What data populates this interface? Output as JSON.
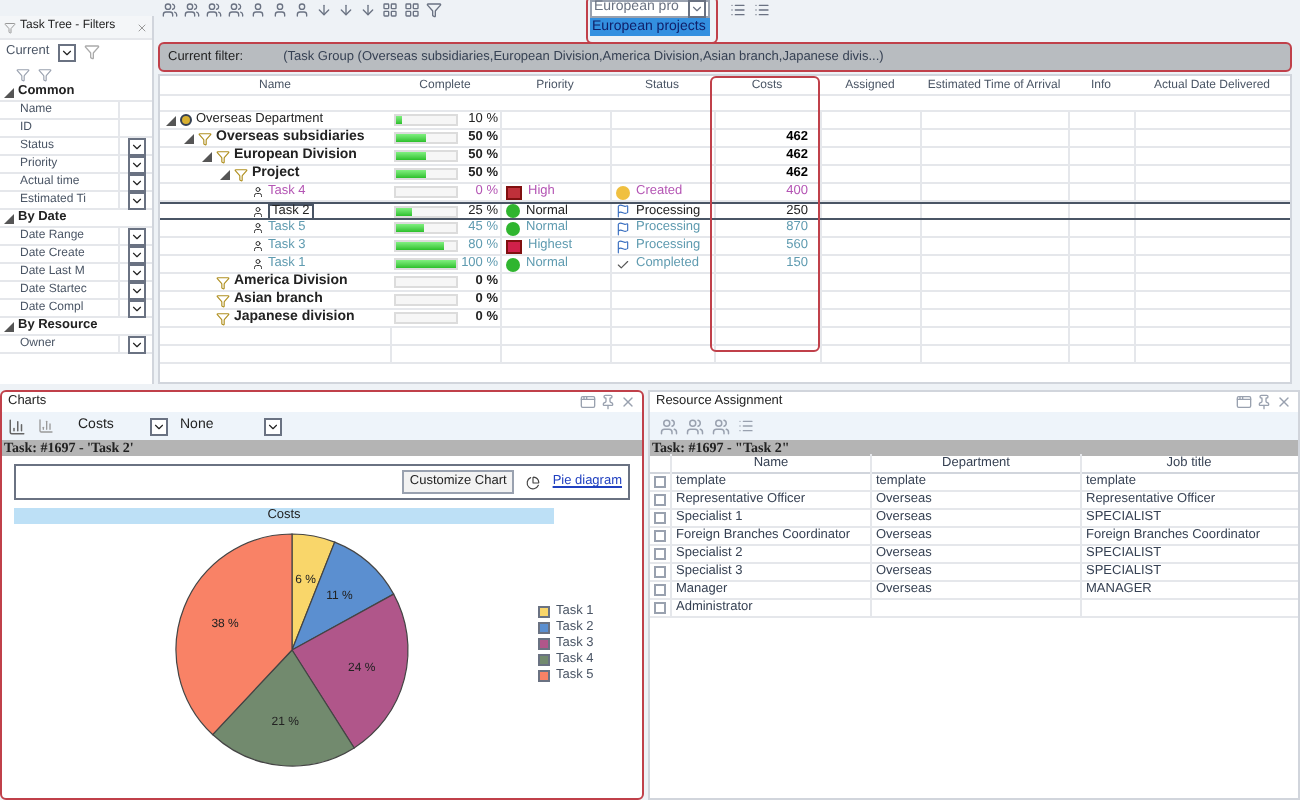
{
  "toolbar": {
    "dropdown": {
      "value": "European pro",
      "options": [
        {
          "label": "European projects",
          "selected": true
        }
      ]
    }
  },
  "filter_panel": {
    "title": "Task Tree - Filters",
    "preset": "Current",
    "sections": [
      {
        "title": "Common",
        "expanded": true,
        "fields": [
          {
            "label": "Name",
            "kind": "text"
          },
          {
            "label": "ID",
            "kind": "text"
          },
          {
            "label": "Status",
            "kind": "select"
          },
          {
            "label": "Priority",
            "kind": "select"
          },
          {
            "label": "Actual time",
            "kind": "select"
          },
          {
            "label": "Estimated Ti",
            "kind": "select"
          }
        ]
      },
      {
        "title": "By Date",
        "expanded": true,
        "fields": [
          {
            "label": "Date Range",
            "kind": "select"
          },
          {
            "label": "Date Create",
            "kind": "select"
          },
          {
            "label": "Date Last M",
            "kind": "select"
          },
          {
            "label": "Date Startec",
            "kind": "select"
          },
          {
            "label": "Date Compl",
            "kind": "select"
          }
        ]
      },
      {
        "title": "By Resource",
        "expanded": true,
        "fields": [
          {
            "label": "Owner",
            "kind": "select"
          }
        ]
      }
    ]
  },
  "filter_bar": {
    "label": "Current filter:",
    "text": "(Task Group  (Overseas subsidiaries,European Division,America Division,Asian branch,Japanese divis...)"
  },
  "task_table": {
    "columns": [
      "Name",
      "Complete",
      "Priority",
      "Status",
      "Costs",
      "Assigned",
      "Estimated Time of Arrival",
      "Info",
      "Actual Date Delivered"
    ],
    "rows": [
      {
        "kind": "department",
        "name": "Overseas Department",
        "complete": "10 %",
        "level": 0.1,
        "expanded": true,
        "selected": false,
        "children": [
          {
            "kind": "group",
            "name": "Overseas subsidiaries",
            "complete": "50 %",
            "level": 0.5,
            "costs": "462",
            "expanded": true,
            "selected": false,
            "children": [
              {
                "kind": "group",
                "name": "European Division",
                "complete": "50 %",
                "level": 0.5,
                "costs": "462",
                "expanded": true,
                "selected": false,
                "children": [
                  {
                    "kind": "group",
                    "name": "Project",
                    "complete": "50 %",
                    "level": 0.5,
                    "costs": "462",
                    "expanded": true,
                    "selected": false,
                    "children": [
                      {
                        "kind": "task",
                        "name": "Task 4",
                        "complete": "0 %",
                        "priority": {
                          "kind": "high",
                          "label": "High"
                        },
                        "status": {
                          "kind": "created",
                          "label": "Created"
                        },
                        "costs": "400",
                        "color": "#b455b4",
                        "selected": false
                      },
                      {
                        "kind": "task",
                        "name": "Task 2",
                        "complete": "25 %",
                        "level": 0.25,
                        "priority": {
                          "kind": "normal",
                          "label": "Normal"
                        },
                        "status": {
                          "kind": "processing",
                          "label": "Processing"
                        },
                        "costs": "250",
                        "color": "#222222",
                        "selected": true
                      },
                      {
                        "kind": "task",
                        "name": "Task 5",
                        "complete": "45 %",
                        "level": 0.45,
                        "priority": {
                          "kind": "normal",
                          "label": "Normal"
                        },
                        "status": {
                          "kind": "processing",
                          "label": "Processing"
                        },
                        "costs": "870",
                        "color": "#5f9bb0",
                        "selected": false
                      },
                      {
                        "kind": "task",
                        "name": "Task 3",
                        "complete": "80 %",
                        "level": 0.8,
                        "priority": {
                          "kind": "highest",
                          "label": "Highest"
                        },
                        "status": {
                          "kind": "processing",
                          "label": "Processing"
                        },
                        "costs": "560",
                        "color": "#5f9bb0",
                        "selected": false
                      },
                      {
                        "kind": "task",
                        "name": "Task 1",
                        "complete": "100 %",
                        "level": 1,
                        "priority": {
                          "kind": "normal",
                          "label": "Normal"
                        },
                        "status": {
                          "kind": "completed",
                          "label": "Completed"
                        },
                        "costs": "150",
                        "color": "#5f9bb0",
                        "selected": false
                      }
                    ]
                  }
                ]
              },
              {
                "kind": "group",
                "name": "America Division",
                "complete": "0 %",
                "selected": false
              },
              {
                "kind": "group",
                "name": "Asian branch",
                "complete": "0 %",
                "selected": false
              },
              {
                "kind": "group",
                "name": "Japanese division",
                "complete": "0 %",
                "selected": false
              }
            ]
          }
        ]
      }
    ]
  },
  "charts_panel": {
    "title": "Charts",
    "metric": "Costs",
    "grouping": "None",
    "task_bar": "Task: #1697 - 'Task 2'",
    "customize_button": "Customize Chart",
    "diagram_link": "Pie diagram",
    "chart_data": {
      "type": "pie",
      "title": "Costs",
      "categories": [
        "Task 1",
        "Task 2",
        "Task 3",
        "Task 4",
        "Task 5"
      ],
      "values": [
        6,
        11,
        24,
        21,
        38
      ],
      "colors": [
        "#f9d66a",
        "#5b8fd0",
        "#b0568a",
        "#728a6e",
        "#f98266"
      ],
      "legend": "right",
      "value_labels": [
        "6 %",
        "11 %",
        "24 %",
        "21 %",
        "38 %"
      ]
    }
  },
  "resource_panel": {
    "title": "Resource Assignment",
    "task_bar": "Task: #1697 - \"Task 2\"",
    "columns": [
      "Name",
      "Department",
      "Job title"
    ],
    "rows": [
      {
        "checked": false,
        "cells": [
          "template",
          "template",
          "template"
        ]
      },
      {
        "checked": false,
        "cells": [
          "Representative Officer",
          "Overseas",
          "Representative Officer"
        ]
      },
      {
        "checked": false,
        "cells": [
          "Specialist 1",
          "Overseas",
          "SPECIALIST"
        ]
      },
      {
        "checked": false,
        "cells": [
          "Foreign Branches Coordinator",
          "Overseas",
          "Foreign Branches Coordinator"
        ]
      },
      {
        "checked": false,
        "cells": [
          "Specialist 2",
          "Overseas",
          "SPECIALIST"
        ]
      },
      {
        "checked": false,
        "cells": [
          "Specialist 3",
          "Overseas",
          "SPECIALIST"
        ]
      },
      {
        "checked": false,
        "cells": [
          "Manager",
          "Overseas",
          "MANAGER"
        ]
      },
      {
        "checked": false,
        "cells": [
          "Administrator",
          "",
          ""
        ]
      }
    ]
  }
}
